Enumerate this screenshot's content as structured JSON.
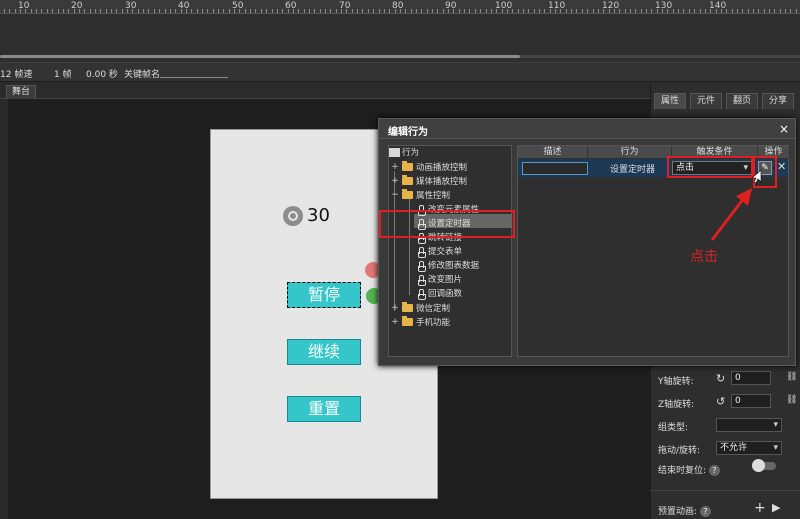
{
  "ruler": {
    "labels": [
      "10",
      "20",
      "30",
      "40",
      "50",
      "60",
      "70",
      "80",
      "90",
      "100",
      "110",
      "120",
      "130",
      "140"
    ]
  },
  "status": {
    "fps": "12 帧速",
    "frame": "1 帧",
    "time": "0.00 秒",
    "keyname_label": "关键帧名"
  },
  "stage": {
    "tab": "舞台",
    "timer_value": "30",
    "buttons": {
      "pause": "暂停",
      "resume": "继续",
      "reset": "重置"
    }
  },
  "right_panel": {
    "tabs": [
      "属性",
      "元件",
      "翻页",
      "分享"
    ],
    "y_rotate_label": "Y轴旋转:",
    "y_rotate_value": "0",
    "z_rotate_label": "Z轴旋转:",
    "z_rotate_value": "0",
    "group_type_label": "组类型:",
    "group_type_value": "",
    "drag_rotate_label": "拖动/旋转:",
    "drag_rotate_value": "不允许",
    "reset_on_end_label": "结束时复位:",
    "preset_anim_label": "预置动画:"
  },
  "dialog": {
    "title": "编辑行为",
    "close": "×",
    "tree": {
      "root": "行为",
      "items": [
        {
          "expander": "+",
          "type": "folder",
          "label": "动画播放控制"
        },
        {
          "expander": "+",
          "type": "folder",
          "label": "媒体播放控制"
        },
        {
          "expander": "−",
          "type": "folder",
          "label": "属性控制"
        },
        {
          "type": "hand",
          "label": "改变元素属性"
        },
        {
          "type": "hand",
          "label": "设置定时器"
        },
        {
          "type": "hand",
          "label": "跳转链接"
        },
        {
          "type": "hand",
          "label": "提交表单"
        },
        {
          "type": "hand",
          "label": "修改图表数据"
        },
        {
          "type": "hand",
          "label": "改变图片"
        },
        {
          "type": "hand",
          "label": "回调函数"
        },
        {
          "expander": "+",
          "type": "folder",
          "label": "微信定制"
        },
        {
          "expander": "+",
          "type": "folder",
          "label": "手机功能"
        }
      ]
    },
    "table": {
      "headers": [
        "描述",
        "行为",
        "触发条件",
        "操作"
      ],
      "row": {
        "description": "",
        "behavior": "设置定时器",
        "trigger": "点击",
        "edit": "✎",
        "delete": "✕"
      }
    }
  },
  "annotation": {
    "text": "点击",
    "color": "#e02020"
  },
  "colors": {
    "button_fill": "#34c6c9",
    "selection_row": "#1c3a56"
  }
}
